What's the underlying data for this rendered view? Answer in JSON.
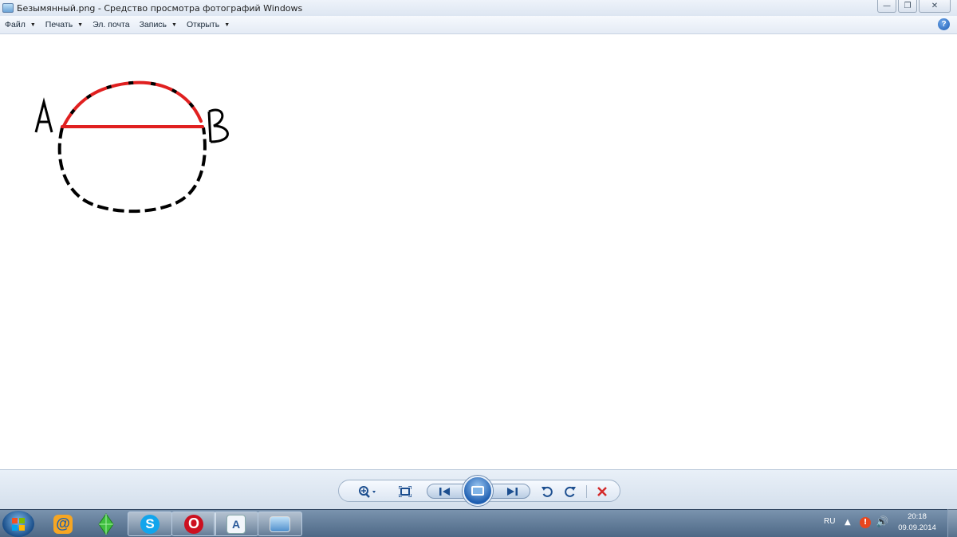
{
  "window": {
    "title": "Безымянный.png - Средство просмотра фотографий Windows"
  },
  "menu": {
    "items": [
      {
        "label": "Файл",
        "has_dropdown": true
      },
      {
        "label": "Печать",
        "has_dropdown": true
      },
      {
        "label": "Эл. почта",
        "has_dropdown": false
      },
      {
        "label": "Запись",
        "has_dropdown": true
      },
      {
        "label": "Открыть",
        "has_dropdown": true
      }
    ],
    "help_label": "?"
  },
  "image": {
    "label_a": "A",
    "label_b": "B",
    "colors": {
      "chord": "#e02020",
      "upper_arc": "#e02020",
      "lower_arc": "#000000"
    }
  },
  "controls": {
    "icons": [
      "zoom-icon",
      "fit-window-icon",
      "previous-icon",
      "slideshow-icon",
      "next-icon",
      "rotate-left-icon",
      "rotate-right-icon",
      "delete-icon"
    ]
  },
  "taskbar": {
    "apps": [
      "start",
      "mail-ru-agent",
      "sims",
      "skype",
      "opera",
      "wordpad",
      "photo-viewer"
    ],
    "language": "RU",
    "time": "20:18",
    "date": "09.09.2014"
  }
}
